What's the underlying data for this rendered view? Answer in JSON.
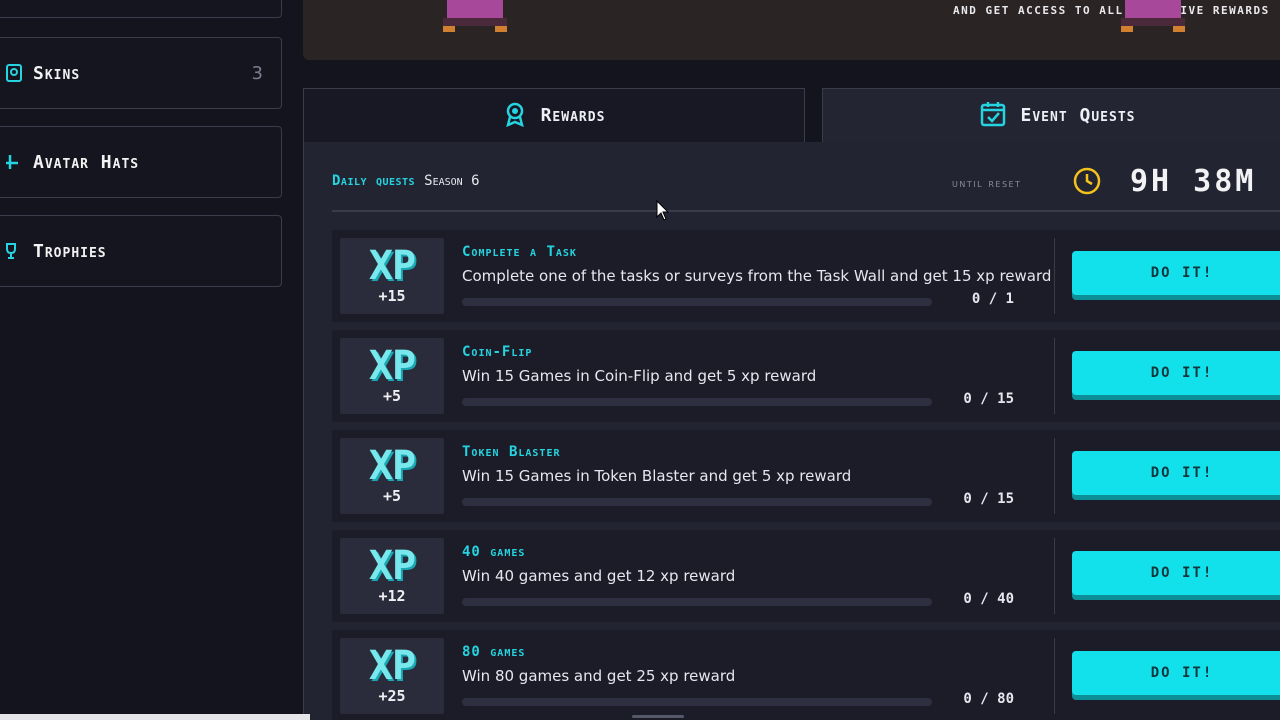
{
  "sidebar": {
    "items": [
      {
        "label": "",
        "count": ""
      },
      {
        "label": "Skins",
        "count": "3"
      },
      {
        "label": "Avatar Hats",
        "count": ""
      },
      {
        "label": "Trophies",
        "count": ""
      }
    ]
  },
  "banner": {
    "text": "AND GET ACCESS TO ALL EXCLUSIVE REWARDS"
  },
  "tabs": {
    "rewards": "Rewards",
    "event_quests": "Event Quests"
  },
  "header": {
    "daily_label": "Daily quests",
    "season": "Season 6",
    "until_reset": "until reset",
    "timer": "9H 38M"
  },
  "quests": [
    {
      "title": "Complete a Task",
      "description": "Complete one of the tasks or surveys from the Task Wall and get 15 xp reward",
      "xp": "+15",
      "progress_text": "0 / 1",
      "progress": 0,
      "button": "DO IT!"
    },
    {
      "title": "Coin-Flip",
      "description": "Win 15 Games in Coin-Flip and get 5 xp reward",
      "xp": "+5",
      "progress_text": "0 / 15",
      "progress": 0,
      "button": "DO IT!"
    },
    {
      "title": "Token Blaster",
      "description": "Win 15 Games in Token Blaster and get 5 xp reward",
      "xp": "+5",
      "progress_text": "0 / 15",
      "progress": 0,
      "button": "DO IT!"
    },
    {
      "title": "40 games",
      "description": "Win 40 games and get 12 xp reward",
      "xp": "+12",
      "progress_text": "0 / 40",
      "progress": 0,
      "button": "DO IT!"
    },
    {
      "title": "80 games",
      "description": "Win 80 games and get 25 xp reward",
      "xp": "+25",
      "progress_text": "0 / 80",
      "progress": 0,
      "button": "DO IT!"
    }
  ],
  "xp_word": "XP",
  "icons": {
    "skins": "skins-icon",
    "hats": "hat-icon",
    "trophies": "trophy-icon",
    "rewards": "medal-icon",
    "quests": "calendar-check-icon",
    "clock": "clock-icon"
  },
  "colors": {
    "accent": "#25d4e0",
    "button": "#12e1ec",
    "clock": "#f4c21b",
    "background": "#14141f"
  }
}
